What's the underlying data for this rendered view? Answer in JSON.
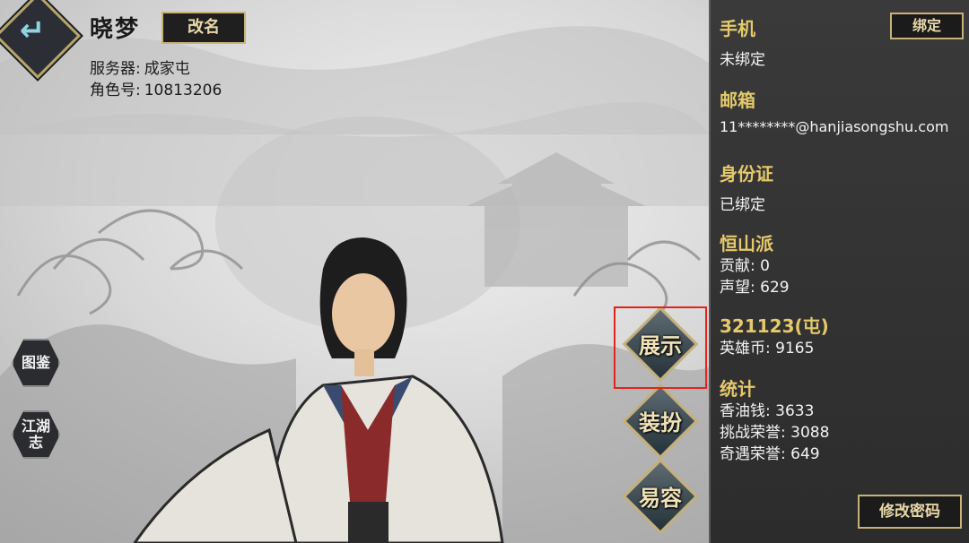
{
  "header": {
    "name": "晓梦",
    "rename_label": "改名",
    "server_label": "服务器:",
    "server_value": "成家屯",
    "role_label": "角色号:",
    "role_value": "10813206"
  },
  "side_buttons": [
    "图鉴",
    "江湖\n志"
  ],
  "actions": [
    "展示",
    "装扮",
    "易容"
  ],
  "panel": {
    "phone_title": "手机",
    "phone_bind_button": "绑定",
    "phone_status": "未绑定",
    "email_title": "邮箱",
    "email_value": "11********@hanjiasongshu.com",
    "id_title": "身份证",
    "id_status": "已绑定",
    "sect_title": "恒山派",
    "sect_contribution": "贡献: 0",
    "sect_reputation": "声望: 629",
    "server_title": "321123(屯)",
    "hero_coins": "英雄币: 9165",
    "stats_title": "统计",
    "incense_money": "香油钱: 3633",
    "challenge_honor": "挑战荣誉: 3088",
    "encounter_honor": "奇遇荣誉: 649",
    "change_password": "修改密码"
  },
  "colors": {
    "accent_gold": "#e5c96b",
    "panel_bg": "#2f2f2f",
    "highlight_red": "#e2241c"
  },
  "icons": {
    "back": "back-arrow-icon"
  }
}
